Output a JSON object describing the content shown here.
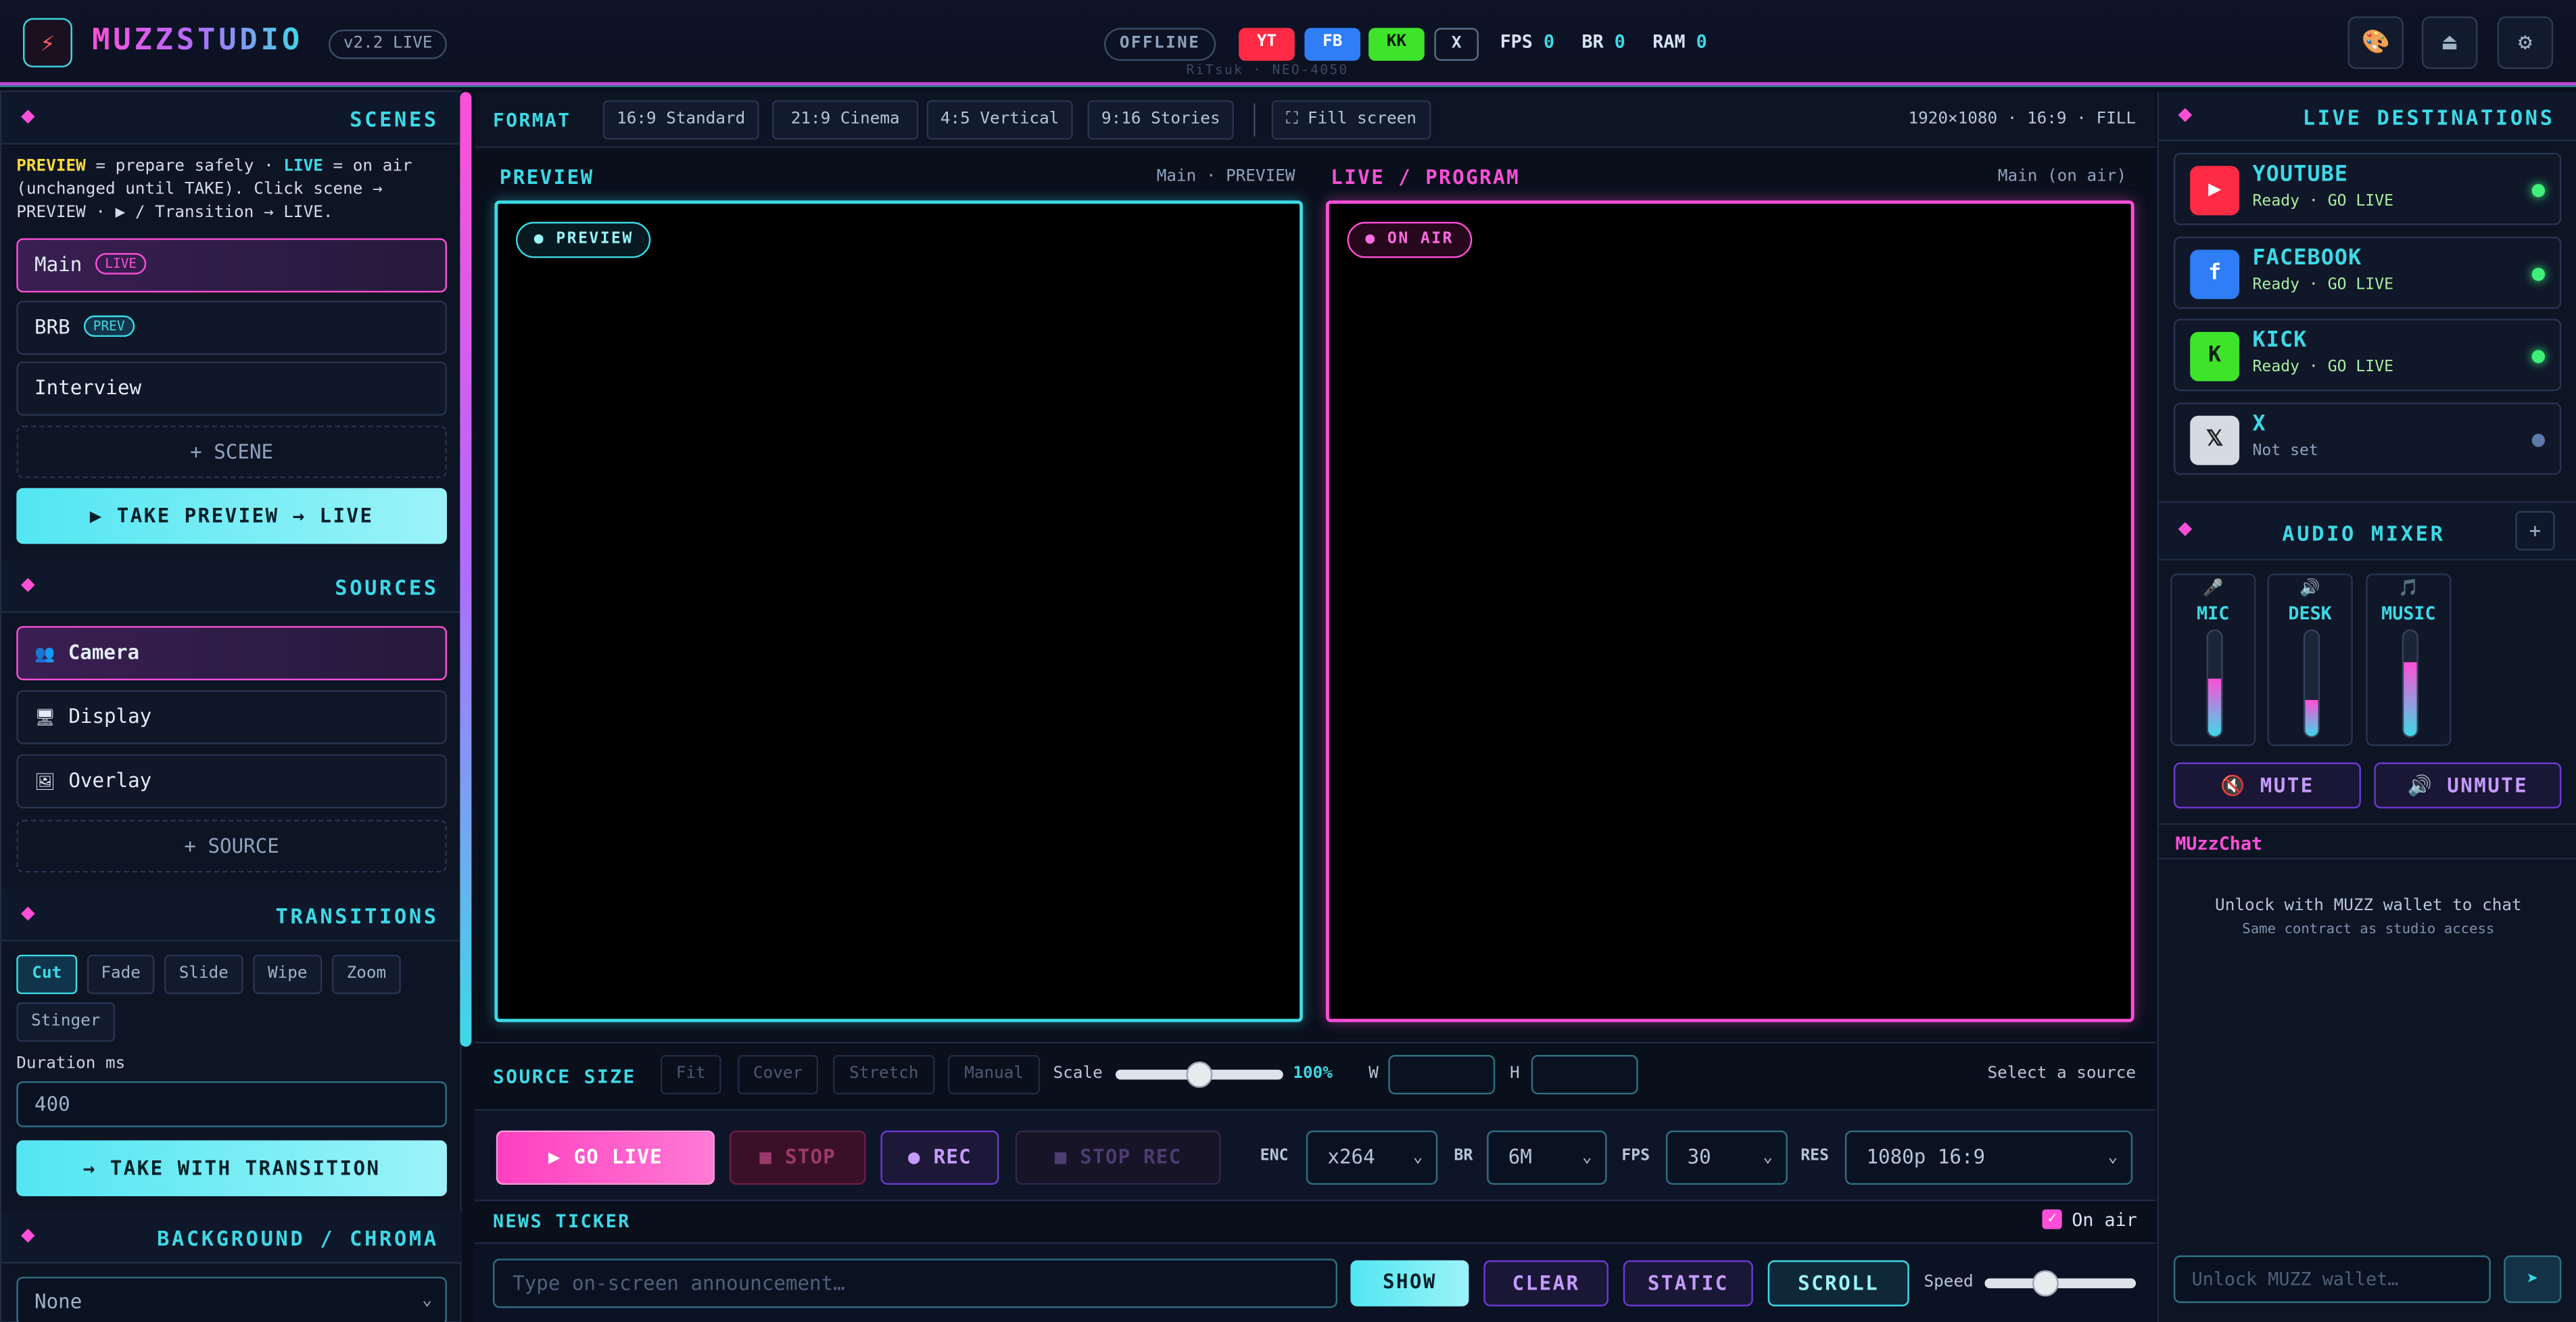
{
  "app": {
    "logo_glyph": "⚡",
    "brand": "MUZZSTUDIO",
    "version": "v2.2 LIVE",
    "status": "OFFLINE",
    "subtitle": "RiTsuk · NEO-4050",
    "platforms": [
      "YT",
      "FB",
      "KK",
      "X"
    ],
    "stats": {
      "fps_label": "FPS",
      "fps": "0",
      "br_label": "BR",
      "br": "0",
      "ram_label": "RAM",
      "ram": "0"
    },
    "toolbar_icons": [
      "palette-icon",
      "eject-icon",
      "settings-icon"
    ]
  },
  "scenes": {
    "title": "SCENES",
    "note_preview": "PREVIEW",
    "note_mid": " = prepare safely · ",
    "note_live": "LIVE",
    "note_rest": " = on air (unchanged until TAKE). Click scene → PREVIEW · ▶ / Transition → LIVE.",
    "items": [
      {
        "name": "Main",
        "tag": "LIVE"
      },
      {
        "name": "BRB",
        "tag": "PREV"
      },
      {
        "name": "Interview",
        "tag": ""
      }
    ],
    "add_label": "+ SCENE",
    "take_label": "▶ TAKE PREVIEW → LIVE"
  },
  "sources": {
    "title": "SOURCES",
    "items": [
      {
        "icon": "👥",
        "name": "Camera"
      },
      {
        "icon": "🖥",
        "name": "Display"
      },
      {
        "icon": "🖼",
        "name": "Overlay"
      }
    ],
    "add_label": "+ SOURCE"
  },
  "transitions": {
    "title": "TRANSITIONS",
    "options": [
      "Cut",
      "Fade",
      "Slide",
      "Wipe",
      "Zoom",
      "Stinger"
    ],
    "selected": "Cut",
    "duration_label": "Duration ms",
    "duration_value": "400",
    "take_label": "→ TAKE WITH TRANSITION"
  },
  "background": {
    "title": "BACKGROUND / CHROMA",
    "value": "None"
  },
  "format": {
    "label": "FORMAT",
    "options": [
      "16:9 Standard",
      "21:9 Cinema",
      "4:5 Vertical",
      "9:16 Stories"
    ],
    "fill_label": "⛶ Fill screen",
    "info": "1920×1080 · 16:9 · FILL"
  },
  "monitors": {
    "preview": {
      "title": "PREVIEW",
      "sub": "Main · PREVIEW",
      "badge": "● PREVIEW"
    },
    "program": {
      "title": "LIVE / PROGRAM",
      "sub": "Main (on air)",
      "badge": "● ON AIR"
    }
  },
  "source_size": {
    "label": "SOURCE SIZE",
    "modes": [
      "Fit",
      "Cover",
      "Stretch",
      "Manual"
    ],
    "scale_label": "Scale",
    "scale_value": "100%",
    "scale_fraction": 0.5,
    "w_label": "W",
    "h_label": "H",
    "hint": "Select a source"
  },
  "controls": {
    "go_live": "▶ GO LIVE",
    "stop": "■ STOP",
    "rec": "● REC",
    "stop_rec": "■ STOP REC",
    "enc_label": "ENC",
    "enc": "x264",
    "br_label": "BR",
    "br": "6M",
    "fps_label": "FPS",
    "fps": "30",
    "res_label": "RES",
    "res": "1080p 16:9"
  },
  "ticker": {
    "label": "NEWS TICKER",
    "on_air_label": "On air",
    "on_air_checked": true,
    "placeholder": "Type on-screen announcement…",
    "show": "SHOW",
    "clear": "CLEAR",
    "static": "STATIC",
    "scroll": "SCROLL",
    "speed_label": "Speed",
    "speed_fraction": 0.4
  },
  "destinations": {
    "title": "LIVE DESTINATIONS",
    "items": [
      {
        "icon": "▶",
        "name": "YOUTUBE",
        "status": "Ready · GO LIVE",
        "color": "#ff2b45",
        "ready": true
      },
      {
        "icon": "f",
        "name": "FACEBOOK",
        "status": "Ready · GO LIVE",
        "color": "#2f7df7",
        "ready": true
      },
      {
        "icon": "K",
        "name": "KICK",
        "status": "Ready · GO LIVE",
        "color": "#3ee42a",
        "ready": true
      },
      {
        "icon": "𝕏",
        "name": "X",
        "status": "Not set",
        "color": "#d6dbe2",
        "ready": false
      }
    ]
  },
  "mixer": {
    "title": "AUDIO MIXER",
    "add": "+",
    "channels": [
      {
        "icon": "🎤",
        "name": "MIC",
        "level": 0.55
      },
      {
        "icon": "🔊",
        "name": "DESK",
        "level": 0.35
      },
      {
        "icon": "🎵",
        "name": "MUSIC",
        "level": 0.7
      }
    ],
    "mute": "🔇 MUTE",
    "unmute": "🔊 UNMUTE"
  },
  "chat": {
    "title": "MUzzChat",
    "line1": "Unlock with MUZZ wallet to chat",
    "line2": "Same contract as studio access",
    "placeholder": "Unlock MUZZ wallet…",
    "send": "➤"
  }
}
